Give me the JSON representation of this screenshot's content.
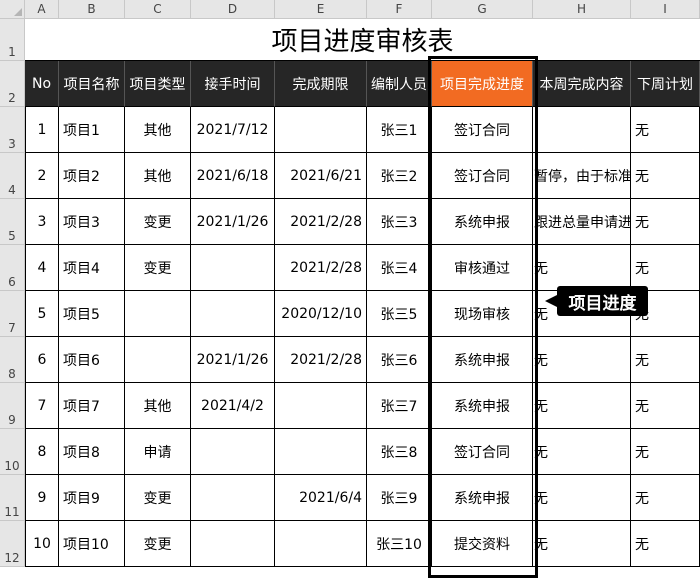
{
  "columns": [
    "A",
    "B",
    "C",
    "D",
    "E",
    "F",
    "G",
    "H",
    "I"
  ],
  "rows": [
    "1",
    "2",
    "3",
    "4",
    "5",
    "6",
    "7",
    "8",
    "9",
    "10",
    "11",
    "12"
  ],
  "title": "项目进度审核表",
  "headers": [
    "No",
    "项目名称",
    "项目类型",
    "接手时间",
    "完成期限",
    "编制人员",
    "项目完成进度",
    "本周完成内容",
    "下周计划"
  ],
  "data_rows": [
    {
      "no": "1",
      "name": "项目1",
      "type": "其他",
      "start": "2021/7/12",
      "deadline": "",
      "staff": "张三1",
      "progress": "签订合同",
      "week": "",
      "next": "无"
    },
    {
      "no": "2",
      "name": "项目2",
      "type": "其他",
      "start": "2021/6/18",
      "deadline": "2021/6/21",
      "staff": "张三2",
      "progress": "签订合同",
      "week": "暂停，由于标准",
      "next": "无"
    },
    {
      "no": "3",
      "name": "项目3",
      "type": "变更",
      "start": "2021/1/26",
      "deadline": "2021/2/28",
      "staff": "张三3",
      "progress": "系统申报",
      "week": "跟进总量申请进",
      "next": "无"
    },
    {
      "no": "4",
      "name": "项目4",
      "type": "变更",
      "start": "",
      "deadline": "2021/2/28",
      "staff": "张三4",
      "progress": "审核通过",
      "week": "无",
      "next": "无"
    },
    {
      "no": "5",
      "name": "项目5",
      "type": "",
      "start": "",
      "deadline": "2020/12/10",
      "staff": "张三5",
      "progress": "现场审核",
      "week": "无",
      "next": "无"
    },
    {
      "no": "6",
      "name": "项目6",
      "type": "",
      "start": "2021/1/26",
      "deadline": "2021/2/28",
      "staff": "张三6",
      "progress": "系统申报",
      "week": "无",
      "next": "无"
    },
    {
      "no": "7",
      "name": "项目7",
      "type": "其他",
      "start": "2021/4/2",
      "deadline": "",
      "staff": "张三7",
      "progress": "系统申报",
      "week": "无",
      "next": "无"
    },
    {
      "no": "8",
      "name": "项目8",
      "type": "申请",
      "start": "",
      "deadline": "",
      "staff": "张三8",
      "progress": "签订合同",
      "week": "无",
      "next": "无"
    },
    {
      "no": "9",
      "name": "项目9",
      "type": "变更",
      "start": "",
      "deadline": "2021/6/4",
      "staff": "张三9",
      "progress": "系统申报",
      "week": "无",
      "next": "无"
    },
    {
      "no": "10",
      "name": "项目10",
      "type": "变更",
      "start": "",
      "deadline": "",
      "staff": "张三10",
      "progress": "提交资料",
      "week": "无",
      "next": "无"
    }
  ],
  "callout": "项目进度",
  "colors": {
    "header_bg": "#262626",
    "accent": "#f26b22"
  }
}
